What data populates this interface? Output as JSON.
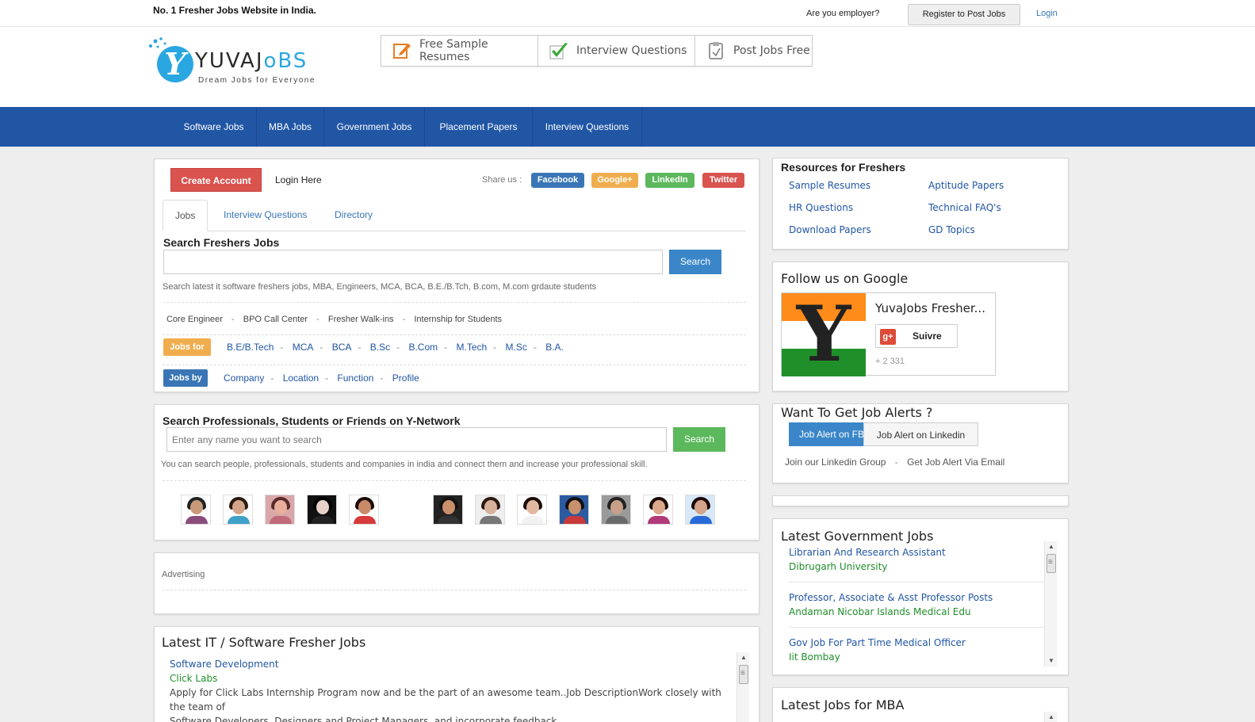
{
  "top": {
    "tagline": "No. 1 Fresher Jobs Website in India.",
    "employer_text": "Are you employer?",
    "register_button": "Register to Post Jobs",
    "login_link": "Login"
  },
  "logo": {
    "letter": "Y",
    "name_a": "YUVAJ",
    "name_b": "BS",
    "tagline": "Dream Jobs for Everyone"
  },
  "quick_links": [
    {
      "label": "Free Sample Resumes",
      "icon": "edit-icon"
    },
    {
      "label": "Interview Questions",
      "icon": "checkmark-icon"
    },
    {
      "label": "Post Jobs Free",
      "icon": "clipboard-icon"
    }
  ],
  "nav": [
    "Software Jobs",
    "MBA Jobs",
    "Government Jobs",
    "Placement Papers",
    "Interview Questions"
  ],
  "main": {
    "create_account": "Create Account",
    "login_here": "Login Here",
    "share_label": "Share us :",
    "share": [
      {
        "label": "Facebook",
        "color": "#3a76b5"
      },
      {
        "label": "Google+",
        "color": "#f0ad4e"
      },
      {
        "label": "LinkedIn",
        "color": "#5cb85c"
      },
      {
        "label": "Twitter",
        "color": "#d9534f"
      }
    ],
    "tabs": [
      "Jobs",
      "Interview Questions",
      "Directory"
    ],
    "search_title": "Search Freshers Jobs",
    "search_input_value": "",
    "search_button": "Search",
    "search_help": "Search latest it software freshers jobs, MBA, Engineers, MCA, BCA, B.E./B.Tch, B.com, M.com grdaute students",
    "categories": [
      "Core Engineer",
      "BPO Call Center",
      "Fresher Walk-ins",
      "Internship for Students"
    ],
    "jobs_for_label": "Jobs for",
    "jobs_for": [
      "B.E/B.Tech",
      "MCA",
      "BCA",
      "B.Sc",
      "B.Com",
      "M.Tech",
      "M.Sc",
      "B.A."
    ],
    "jobs_by_label": "Jobs by",
    "jobs_by": [
      "Company",
      "Location",
      "Function",
      "Profile"
    ]
  },
  "network": {
    "title": "Search Professionals, Students or Friends on Y-Network",
    "placeholder": "Enter any name you want to search",
    "search_button": "Search",
    "help": "You can search people, professionals, students and companies in india and connect them and increase your professional skill."
  },
  "advertising": {
    "label": "Advertising"
  },
  "it_jobs": {
    "title": "Latest IT / Software Fresher Jobs",
    "items": [
      {
        "title": "Software Development",
        "company": "Click Labs",
        "desc_line1": "Apply for Click Labs Internship Program now and be the part of an awesome team..Job DescriptionWork closely with the team of",
        "desc_line2": "Software Developers, Designers and Project Managers, and incorporate feedback......"
      }
    ]
  },
  "resources": {
    "title": "Resources for Freshers",
    "links": [
      "Sample Resumes",
      "Aptitude Papers",
      "HR Questions",
      "Technical FAQ's",
      "Download Papers",
      "GD Topics"
    ]
  },
  "google": {
    "title": "Follow us on Google",
    "page_name": "YuvaJobs Fresher...",
    "flag_letter": "Y",
    "gplus_icon_text": "g+",
    "follow_button": "Suivre",
    "followers": "+ 2 331"
  },
  "alerts": {
    "title": "Want To Get Job Alerts ?",
    "fb_button": "Job Alert on FB",
    "linkedin_button": "Job Alert on Linkedin",
    "join_linkedin": "Join our Linkedin Group",
    "email_alert": "Get Job Alert Via Email"
  },
  "gov_jobs": {
    "title": "Latest Government Jobs",
    "items": [
      {
        "title": "Librarian And Research Assistant",
        "org": "Dibrugarh University"
      },
      {
        "title": "Professor, Associate & Asst Professor Posts",
        "org": "Andaman Nicobar Islands Medical Edu"
      },
      {
        "title": "Gov Job For Part Time Medical Officer",
        "org": "Iit Bombay"
      }
    ]
  },
  "mba_jobs": {
    "title": "Latest Jobs for MBA"
  },
  "colors": {
    "nav_blue": "#2156a5",
    "link_blue": "#2156a5",
    "company_green": "#1f8f2a",
    "red": "#d9534f",
    "orange": "#f0ad4e",
    "green": "#5cb85c",
    "blue_btn": "#3a86c8"
  }
}
